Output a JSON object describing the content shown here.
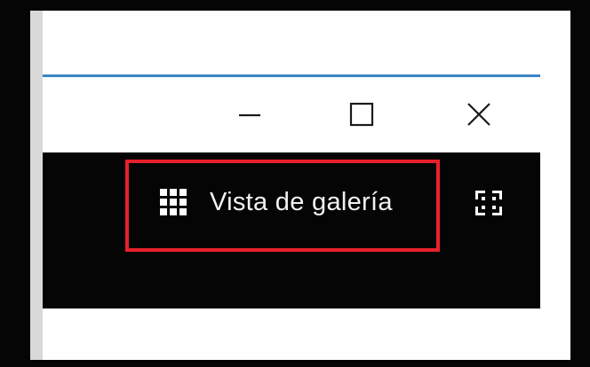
{
  "window": {
    "controls": {
      "minimize_icon": "minimize-icon",
      "maximize_icon": "maximize-icon",
      "close_icon": "close-icon"
    },
    "accent_color": "#3b86c6"
  },
  "toolbar": {
    "background": "#050505",
    "gallery_view_label": "Vista de galería",
    "gallery_view_icon": "grid-icon",
    "fullscreen_icon": "fullscreen-icon"
  },
  "highlight_color": "#e8202a"
}
